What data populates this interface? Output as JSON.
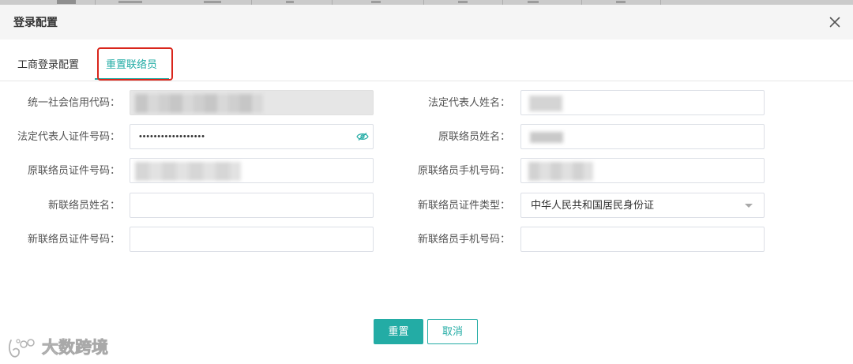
{
  "dialog": {
    "title": "登录配置"
  },
  "tabs": [
    {
      "label": "工商登录配置",
      "active": false
    },
    {
      "label": "重置联络员",
      "active": true
    }
  ],
  "form": {
    "left": [
      {
        "label": "统一社会信用代码："
      },
      {
        "label": "法定代表人证件号码：",
        "value": "••••••••••••••••••"
      },
      {
        "label": "原联络员证件号码："
      },
      {
        "label": "新联络员姓名：",
        "value": ""
      },
      {
        "label": "新联络员证件号码：",
        "value": ""
      }
    ],
    "right": [
      {
        "label": "法定代表人姓名："
      },
      {
        "label": "原联络员姓名："
      },
      {
        "label": "原联络员手机号码："
      },
      {
        "label": "新联络员证件类型：",
        "value": "中华人民共和国居民身份证"
      },
      {
        "label": "新联络员手机号码：",
        "value": ""
      }
    ]
  },
  "buttons": {
    "reset": "重置",
    "cancel": "取消"
  },
  "watermark": "大数跨境",
  "icons": {
    "close": "close-icon",
    "password_toggle": "eye-off-icon",
    "select_caret": "caret-down-icon",
    "watermark_logo": "watermark-logo-icon"
  },
  "colors": {
    "accent": "#23aca5",
    "annotation": "#d9261c"
  }
}
